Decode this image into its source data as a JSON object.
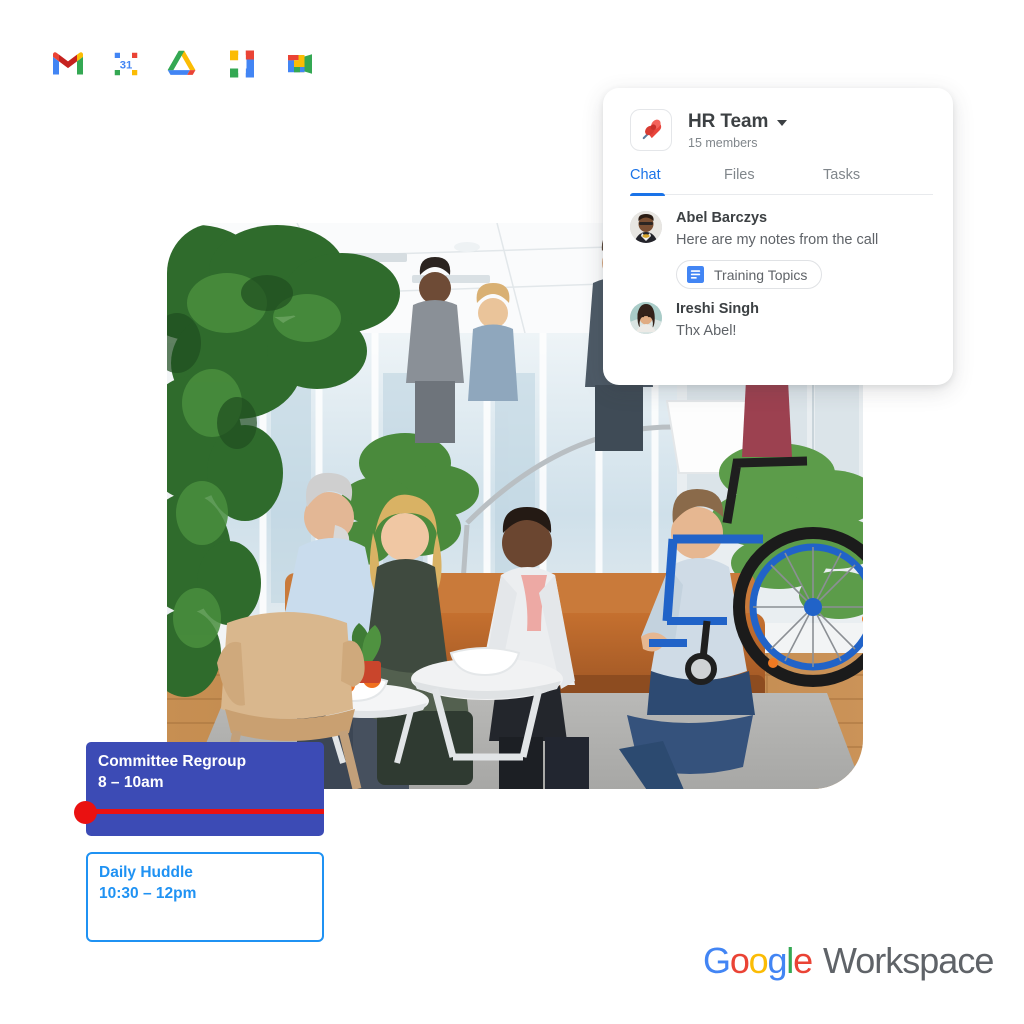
{
  "app_bar": {
    "items": [
      {
        "name": "gmail",
        "label": "Gmail"
      },
      {
        "name": "calendar",
        "label": "Calendar",
        "day_number": "31"
      },
      {
        "name": "drive",
        "label": "Drive"
      },
      {
        "name": "docs",
        "label": "Docs"
      },
      {
        "name": "meet",
        "label": "Meet"
      }
    ]
  },
  "chat_panel": {
    "room_title": "HR Team",
    "members": "15 members",
    "room_icon": "pushpin-icon",
    "caret": "chevron-down-icon",
    "tabs": [
      {
        "label": "Chat",
        "active": true
      },
      {
        "label": "Files",
        "active": false
      },
      {
        "label": "Tasks",
        "active": false
      }
    ],
    "messages": [
      {
        "author": "Abel Barczys",
        "text": "Here are my notes from the call",
        "attachment": {
          "label": "Training Topics",
          "icon": "google-docs-icon"
        }
      },
      {
        "author": "Ireshi Singh",
        "text": "Thx Abel!",
        "attachment": null
      }
    ]
  },
  "calendar_events": [
    {
      "title": "Committee Regroup",
      "time": "8 – 10am",
      "style": "filled",
      "color": "#3c4bb5",
      "current_time_marker": true
    },
    {
      "title": "Daily Huddle",
      "time": "10:30 – 12pm",
      "style": "outlined",
      "color": "#1f92f3",
      "current_time_marker": false
    }
  ],
  "hero_photo": {
    "alt": "Colleagues meeting in a bright modern office lounge",
    "corner_radius_px": 50
  },
  "brand": {
    "google_letters": [
      {
        "char": "G",
        "color": "#4285f4"
      },
      {
        "char": "o",
        "color": "#ea4335"
      },
      {
        "char": "o",
        "color": "#fbbc05"
      },
      {
        "char": "g",
        "color": "#4285f4"
      },
      {
        "char": "l",
        "color": "#34a853"
      },
      {
        "char": "e",
        "color": "#ea4335"
      }
    ],
    "product": "Workspace",
    "accent_blue": "#1a73e8",
    "text_gray": "#5f6368"
  }
}
